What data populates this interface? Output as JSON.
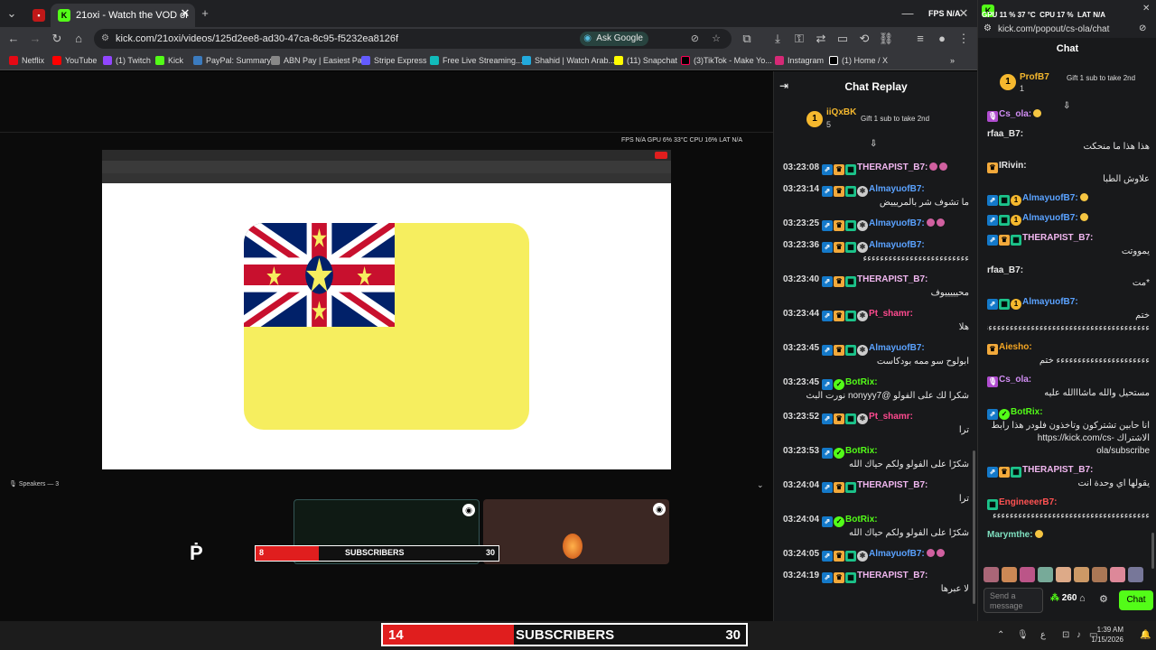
{
  "browser": {
    "tabs": [
      {
        "label": "",
        "favicon": "kick-fav"
      },
      {
        "label": "21oxi - Watch the VOD on K",
        "favicon": "K"
      }
    ],
    "url": "kick.com/21oxi/videos/125d2ee8-ad30-47ca-8c95-f5232ea8126f",
    "ask_google": "Ask Google",
    "bookmarks": [
      "Netflix",
      "YouTube",
      "(1) Twitch",
      "Kick",
      "PayPal: Summary",
      "ABN Pay | Easiest Pa...",
      "Stripe Express",
      "Free Live Streaming...",
      "Shahid | Watch Arab...",
      "(11) Snapchat",
      "(3)TikTok - Make Yo...",
      "Instagram",
      "(1) Home / X"
    ]
  },
  "stats_overlay": {
    "fps_label": "FPS",
    "fps": "N/A",
    "gpu_label": "GPU",
    "gpu": "11 %",
    "gpu_temp": "37 °C",
    "cpu_label": "CPU",
    "cpu": "17 %",
    "lat_label": "LAT",
    "lat": "N/A"
  },
  "stream_stats_small": "FPS N/A   GPU 6% 33°C   CPU 16%   LAT N/A",
  "speakers": "Speakers — 3",
  "subs_small": {
    "current": "8",
    "label": "SUBSCRIBERS",
    "goal": "30",
    "progress": 0.26
  },
  "subs_big": {
    "current": "14",
    "label": "SUBSCRIBERS",
    "goal": "30",
    "progress": 0.36
  },
  "replay": {
    "title": "Chat Replay",
    "pinned_user": "iiQxBK",
    "pinned_count": "5",
    "pinned_text": "Gift 1 sub to take 2nd",
    "messages": [
      {
        "time": "03:23:08",
        "user": "THERAPIST_B7:",
        "color": "#f1b7f0",
        "text": ""
      },
      {
        "time": "03:23:14",
        "user": "AlmayuofB7:",
        "color": "#5aa2ff",
        "text": "ما تشوف شر بالمريييض"
      },
      {
        "time": "03:23:25",
        "user": "AlmayuofB7:",
        "color": "#5aa2ff",
        "text": ""
      },
      {
        "time": "03:23:36",
        "user": "AlmayuofB7:",
        "color": "#5aa2ff",
        "text": "ءءءءءءءءءءءءءءءءءءءءءءءءء"
      },
      {
        "time": "03:23:40",
        "user": "THERAPIST_B7:",
        "color": "#f1b7f0",
        "text": "محيييييوف"
      },
      {
        "time": "03:23:44",
        "user": "Pt_shamr:",
        "color": "#ff4a8f",
        "text": "هلا"
      },
      {
        "time": "03:23:45",
        "user": "AlmayuofB7:",
        "color": "#5aa2ff",
        "text": "ابولوح سو ممه بودكاست"
      },
      {
        "time": "03:23:45",
        "user": "BotRix:",
        "color": "#53fc18",
        "text": "شكرا لك على الفولو @nonyyy7 نورت البث"
      },
      {
        "time": "03:23:52",
        "user": "Pt_shamr:",
        "color": "#ff4a8f",
        "text": "ترا"
      },
      {
        "time": "03:23:53",
        "user": "BotRix:",
        "color": "#53fc18",
        "text": "شكرًا على الفولو ولكم حياك الله"
      },
      {
        "time": "03:24:04",
        "user": "THERAPIST_B7:",
        "color": "#f1b7f0",
        "text": "ترا"
      },
      {
        "time": "03:24:04",
        "user": "BotRix:",
        "color": "#53fc18",
        "text": "شكرًا على الفولو ولكم حياك الله"
      },
      {
        "time": "03:24:05",
        "user": "AlmayuofB7:",
        "color": "#5aa2ff",
        "text": ""
      },
      {
        "time": "03:24:19",
        "user": "THERAPIST_B7:",
        "color": "#f1b7f0",
        "text": "لا عبرها"
      }
    ]
  },
  "popout": {
    "url": "kick.com/popout/cs-ola/chat",
    "title": "Chat",
    "pinned_user": "ProfB7",
    "pinned_count": "1",
    "pinned_text": "Gift 1 sub to take 2nd",
    "messages": [
      {
        "user": "Cs_ola:",
        "color": "#d28ef5",
        "text": ""
      },
      {
        "user": "rfaa_B7:",
        "color": "#e6e6e6",
        "text": "هذا هذا ما منحكت"
      },
      {
        "user": "IRivin:",
        "color": "#e6e6e6",
        "text": "علاوش الطبا"
      },
      {
        "user": "AlmayuofB7:",
        "color": "#5aa2ff",
        "text": ""
      },
      {
        "user": "AlmayuofB7:",
        "color": "#5aa2ff",
        "text": ""
      },
      {
        "user": "THERAPIST_B7:",
        "color": "#f1b7f0",
        "text": "يمووتت"
      },
      {
        "user": "rfaa_B7:",
        "color": "#e6e6e6",
        "text": "*مت"
      },
      {
        "user": "AlmayuofB7:",
        "color": "#5aa2ff",
        "text": "ختم ءءءءءءءءءءءءءءءءءءءءءءءءءءءءءءءءءءءءءءءءءءءءءءءءءءءءءءءءءءءءءءءءءءءءءءءءءءءءءء"
      },
      {
        "user": "Aiesho:",
        "color": "#f5a623",
        "text": "ءءءءءءءءءءءءءءءءءءءءءء ختم"
      },
      {
        "user": "Cs_ola:",
        "color": "#d28ef5",
        "text": "مستحيل والله ماشااالله عليه"
      },
      {
        "user": "BotRix:",
        "color": "#53fc18",
        "text": "انا حابين تشتركون وتاخذون فلودر هذا رابط الاشتراك https://kick.com/cs-ola/subscribe"
      },
      {
        "user": "THERAPIST_B7:",
        "color": "#f1b7f0",
        "text": "يقولها اي وحدة انت"
      },
      {
        "user": "EngineeerB7:",
        "color": "#ff5252",
        "text": "ءءءءءءءءءءءءءءءءءءءءءءءءءءءءءءءءءءءءء"
      },
      {
        "user": "Marymthe:",
        "color": "#7fe0c0",
        "text": ""
      }
    ],
    "input_placeholder": "Send a message",
    "points": "260",
    "chat_button": "Chat"
  },
  "clock": {
    "time": "1:39 AM",
    "date": "1/15/2026"
  },
  "colors": {
    "kick_green": "#53fc18",
    "sub_red": "#e01e1e",
    "panel": "#18191b"
  }
}
